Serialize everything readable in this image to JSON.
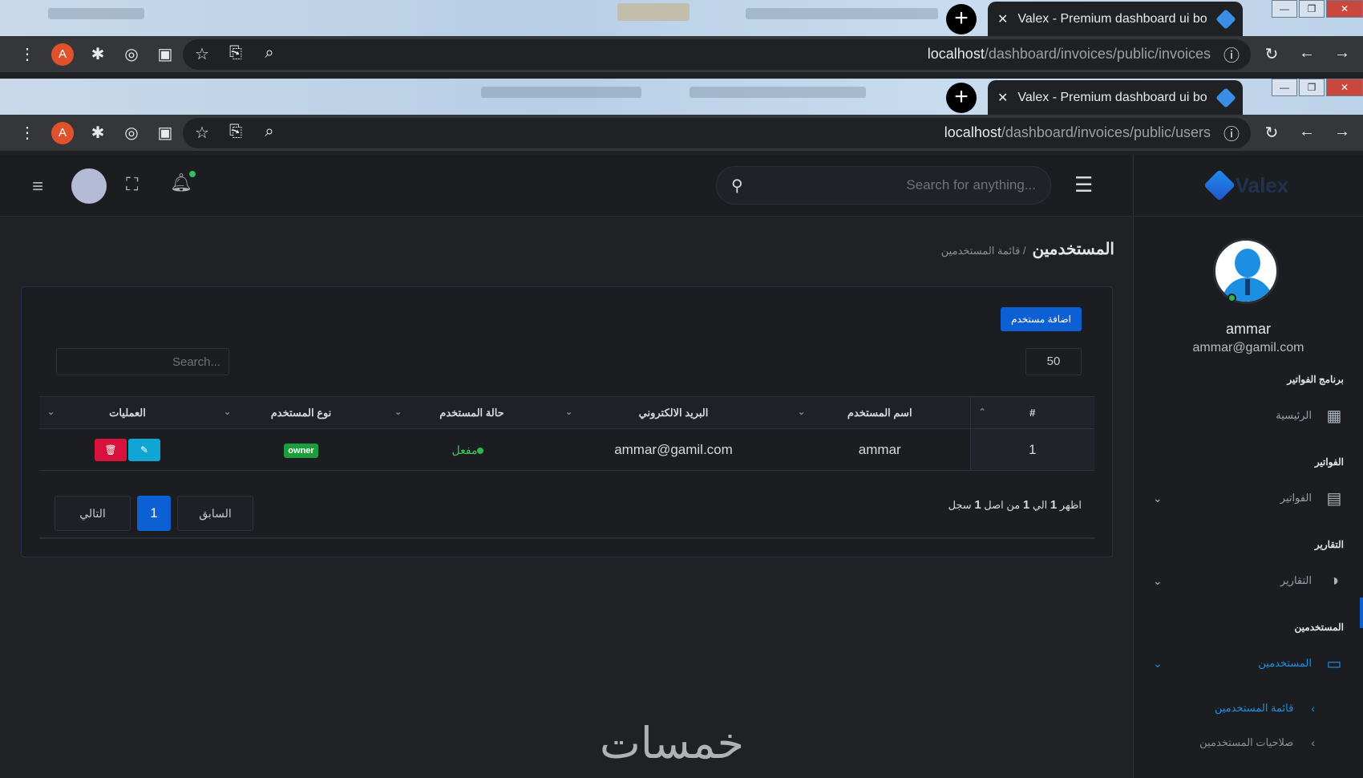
{
  "browser_top": {
    "tab_title": "Valex - Premium dashboard ui bo",
    "url_host": "localhost",
    "url_path": "/dashboard/invoices/public/invoices",
    "profile_initial": "A"
  },
  "browser_main": {
    "tab_title": "Valex - Premium dashboard ui bo",
    "url_host": "localhost",
    "url_path": "/dashboard/invoices/public/users",
    "profile_initial": "A"
  },
  "header": {
    "search_placeholder": "Search for anything..."
  },
  "logo": {
    "text": "Valex"
  },
  "breadcrumb": {
    "title": "المستخدمين",
    "sub": "/ قائمة المستخدمين"
  },
  "card": {
    "add_button": "اضافة مستخدم",
    "page_length": "50",
    "search_placeholder": "Search...",
    "table": {
      "headers": [
        "#",
        "اسم المستخدم",
        "البريد الالكتروني",
        "حالة المستخدم",
        "نوع المستخدم",
        "العمليات"
      ],
      "rows": [
        {
          "index": "1",
          "name": "ammar",
          "email": "ammar@gamil.com",
          "status": "مفعل",
          "role": "owner"
        }
      ]
    },
    "info_parts": [
      "اظهر",
      "1",
      "الي",
      "1",
      "من اصل",
      "1",
      "سجل"
    ],
    "pager": {
      "prev": "السابق",
      "current": "1",
      "next": "التالي"
    }
  },
  "sidebar": {
    "user_name": "ammar",
    "user_email": "ammar@gamil.com",
    "sections": [
      {
        "title": "برنامج الفواتير",
        "item": "الرئيسية",
        "icon": "grid-icon",
        "has_chevron": false
      },
      {
        "title": "الفواتير",
        "item": "الفواتير",
        "icon": "bar-chart-icon",
        "has_chevron": true
      },
      {
        "title": "التقارير",
        "item": "التقارير",
        "icon": "pie-chart-icon",
        "has_chevron": true
      },
      {
        "title": "المستخدمين",
        "item": "المستخدمين",
        "icon": "chat-icon",
        "has_chevron": true
      }
    ],
    "sub_items": [
      "قائمة المستخدمين",
      "صلاحيات المستخدمين"
    ]
  },
  "colors": {
    "accent": "#0d5fd4",
    "active_link": "#1d8fe3",
    "status_green": "#3ecb5c",
    "delete_red": "#d8123d",
    "edit_cyan": "#0fa6d6"
  },
  "watermark": "خمسات"
}
